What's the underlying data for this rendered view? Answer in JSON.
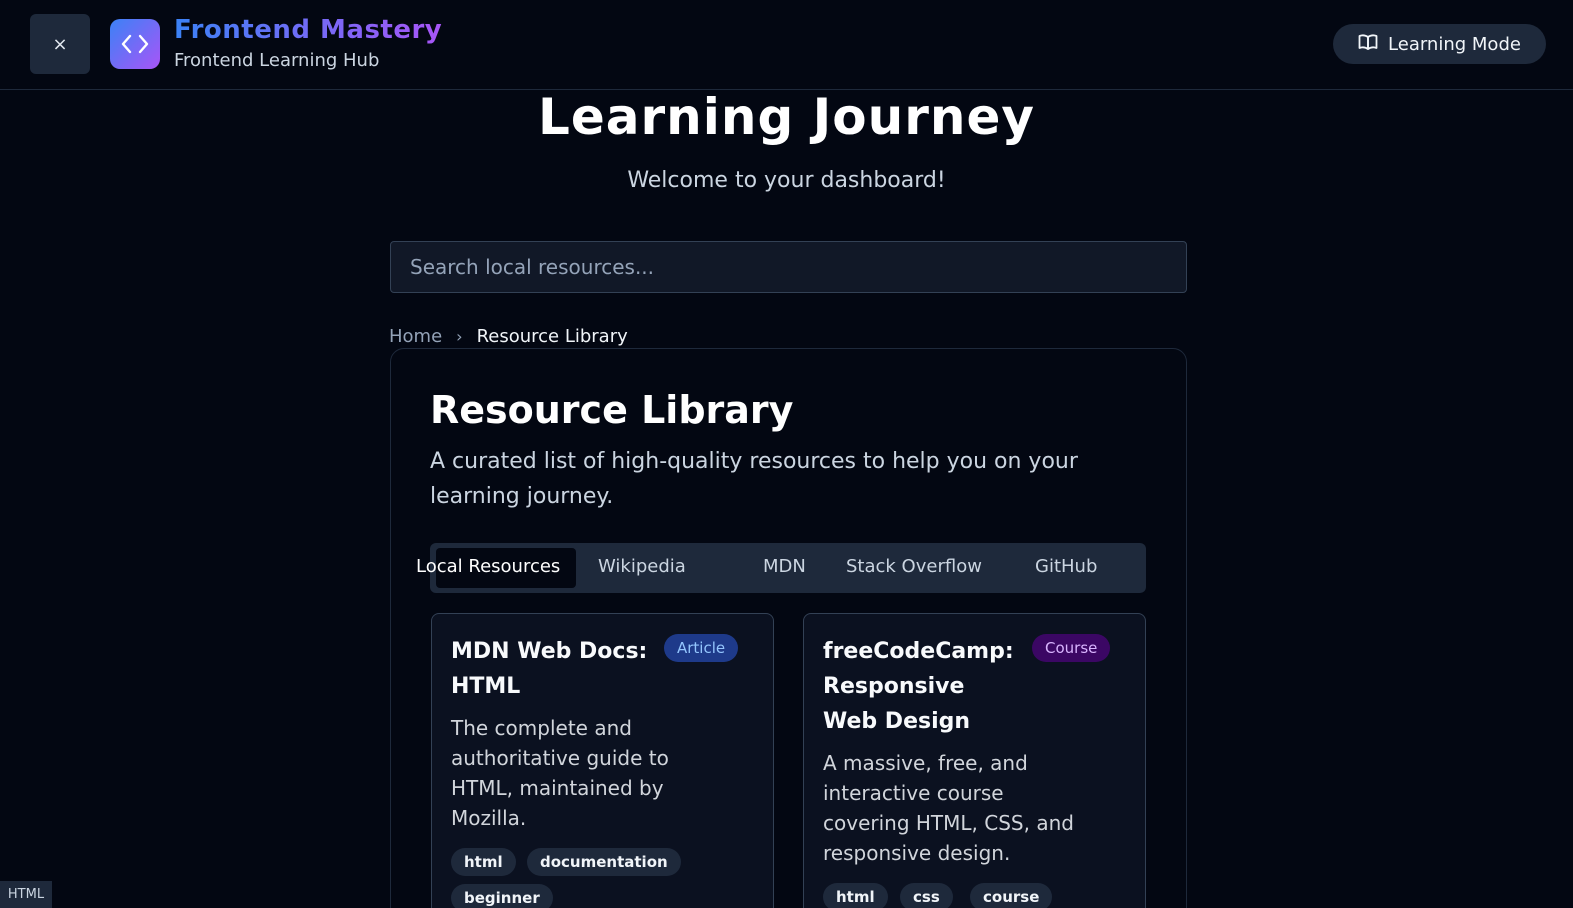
{
  "header": {
    "close_icon": "×",
    "brand_title": "Frontend Mastery",
    "brand_subtitle": "Frontend Learning Hub",
    "mode_button": "Learning Mode",
    "accent_gradient": [
      "#3b82f6",
      "#a855f7"
    ]
  },
  "hero": {
    "title": "Learning Journey",
    "subtitle": "Welcome to your dashboard!"
  },
  "search": {
    "placeholder": "Search local resources..."
  },
  "breadcrumb": {
    "home": "Home",
    "current": "Resource Library"
  },
  "library": {
    "title": "Resource Library",
    "description": "A curated list of high-quality resources to help you on your learning journey.",
    "tabs": [
      {
        "label": "Local Resources",
        "active": true
      },
      {
        "label": "Wikipedia",
        "active": false
      },
      {
        "label": "MDN",
        "active": false
      },
      {
        "label": "Stack Overflow",
        "active": false
      },
      {
        "label": "GitHub",
        "active": false
      }
    ],
    "resources": [
      {
        "title_lines": [
          "MDN Web Docs:",
          "HTML"
        ],
        "badge": "Article",
        "description_lines": [
          "The complete and",
          "authoritative guide to",
          "HTML, maintained by",
          "Mozilla."
        ],
        "tags": [
          "html",
          "documentation",
          "beginner"
        ]
      },
      {
        "title_lines": [
          "freeCodeCamp:",
          "Responsive",
          "Web Design"
        ],
        "badge": "Course",
        "description_lines": [
          "A massive, free, and",
          "interactive course",
          "covering HTML, CSS, and",
          "responsive design."
        ],
        "tags": [
          "html",
          "css",
          "course"
        ]
      }
    ]
  },
  "corner_label": "HTML"
}
